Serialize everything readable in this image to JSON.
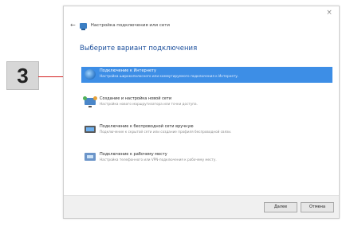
{
  "callout": {
    "label": "3"
  },
  "window": {
    "title": "Настройка подключения или сети",
    "close": "×",
    "back": "←"
  },
  "heading": "Выберите вариант подключения",
  "options": [
    {
      "title": "Подключение к Интернету",
      "desc": "Настройка широкополосного или коммутируемого подключения к Интернету.",
      "icon": "globe-icon"
    },
    {
      "title": "Создание и настройка новой сети",
      "desc": "Настройка нового маршрутизатора или точки доступа.",
      "icon": "network-icon"
    },
    {
      "title": "Подключение к беспроводной сети вручную",
      "desc": "Подключение к скрытой сети или создание профиля беспроводной связи.",
      "icon": "wifi-icon"
    },
    {
      "title": "Подключение к рабочему месту",
      "desc": "Настройка телефонного или VPN-подключения к рабочему месту.",
      "icon": "workplace-icon"
    }
  ],
  "footer": {
    "next": "Далее",
    "cancel": "Отмена"
  }
}
